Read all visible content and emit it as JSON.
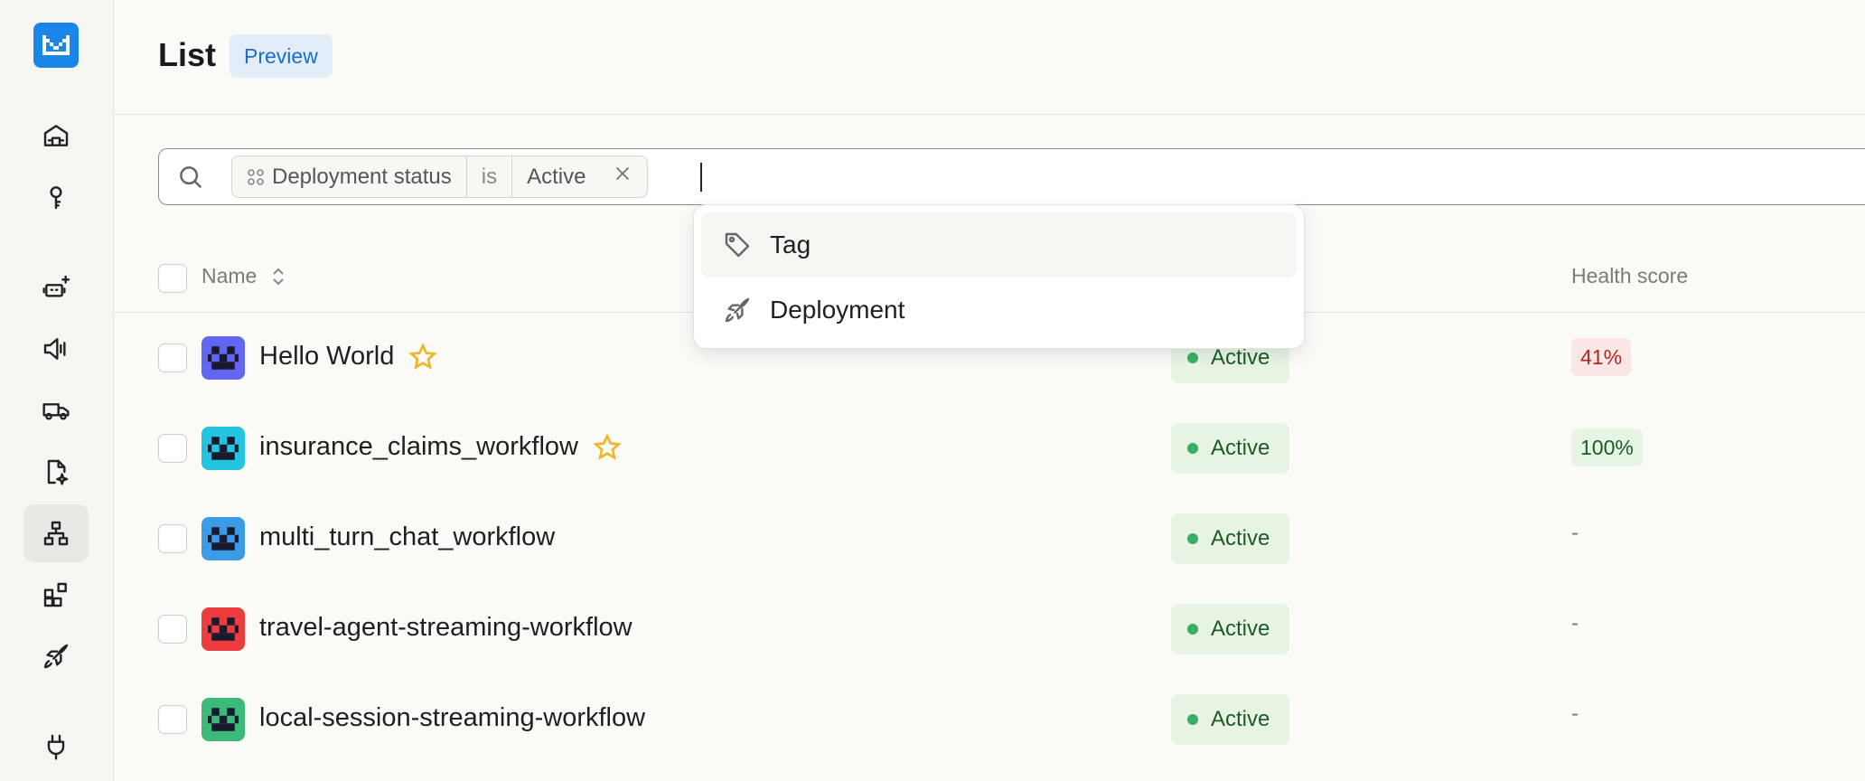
{
  "sidebar": {
    "icons": [
      "home-icon",
      "key-icon",
      "add-bot-icon",
      "megaphone-icon",
      "truck-icon",
      "document-sparkle-icon",
      "workflow-hierarchy-icon",
      "blocks-icon",
      "rocket-icon",
      "plug-icon"
    ],
    "active": "workflow-hierarchy-icon"
  },
  "header": {
    "title": "List",
    "badge": "Preview"
  },
  "search": {
    "filter": {
      "field": "Deployment status",
      "operator": "is",
      "value": "Active"
    }
  },
  "dropdown": {
    "items": [
      {
        "label": "Tag",
        "icon": "tag-icon"
      },
      {
        "label": "Deployment",
        "icon": "rocket-icon"
      }
    ]
  },
  "table": {
    "columns": {
      "name": "Name",
      "health": "Health score"
    },
    "rows": [
      {
        "name": "Hello World",
        "starred": true,
        "status": "Active",
        "health": "41%",
        "avatar_color": "#6366f1"
      },
      {
        "name": "insurance_claims_workflow",
        "starred": true,
        "status": "Active",
        "health": "100%",
        "avatar_color": "#22c4e0"
      },
      {
        "name": "multi_turn_chat_workflow",
        "starred": false,
        "status": "Active",
        "health": "-",
        "avatar_color": "#3b9be6"
      },
      {
        "name": "travel-agent-streaming-workflow",
        "starred": false,
        "status": "Active",
        "health": "-",
        "avatar_color": "#ee3b3b"
      },
      {
        "name": "local-session-streaming-workflow",
        "starred": false,
        "status": "Active",
        "health": "-",
        "avatar_color": "#3dba7a"
      }
    ]
  },
  "colors": {
    "accent": "#1a86e8",
    "status_green": "#3cae64",
    "health_red": "#b3261e",
    "star": "#f0b429"
  }
}
